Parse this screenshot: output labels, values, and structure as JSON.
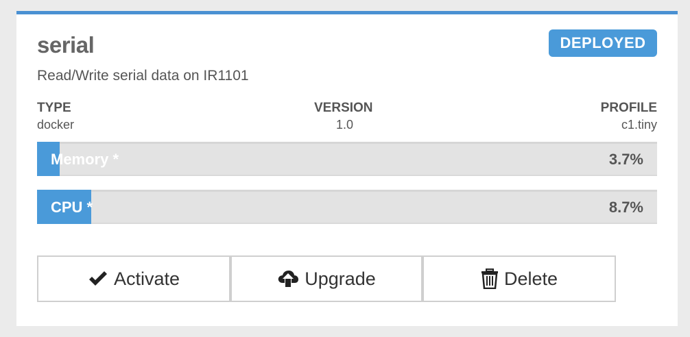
{
  "app": {
    "name": "serial",
    "description": "Read/Write serial data on IR1101",
    "status": "DEPLOYED"
  },
  "meta": {
    "type_label": "TYPE",
    "type_value": "docker",
    "version_label": "VERSION",
    "version_value": "1.0",
    "profile_label": "PROFILE",
    "profile_value": "c1.tiny"
  },
  "usage": {
    "memory": {
      "label": "Memory *",
      "value_text": "3.7%",
      "percent": 3.7
    },
    "cpu": {
      "label": "CPU *",
      "value_text": "8.7%",
      "percent": 8.7
    }
  },
  "actions": {
    "activate": {
      "label": "Activate",
      "icon": "checkmark-icon"
    },
    "upgrade": {
      "label": "Upgrade",
      "icon": "cloud-upload-icon"
    },
    "delete": {
      "label": "Delete",
      "icon": "trash-icon"
    }
  },
  "colors": {
    "accent": "#4a9ad9",
    "bar_track": "#e3e3e3"
  }
}
